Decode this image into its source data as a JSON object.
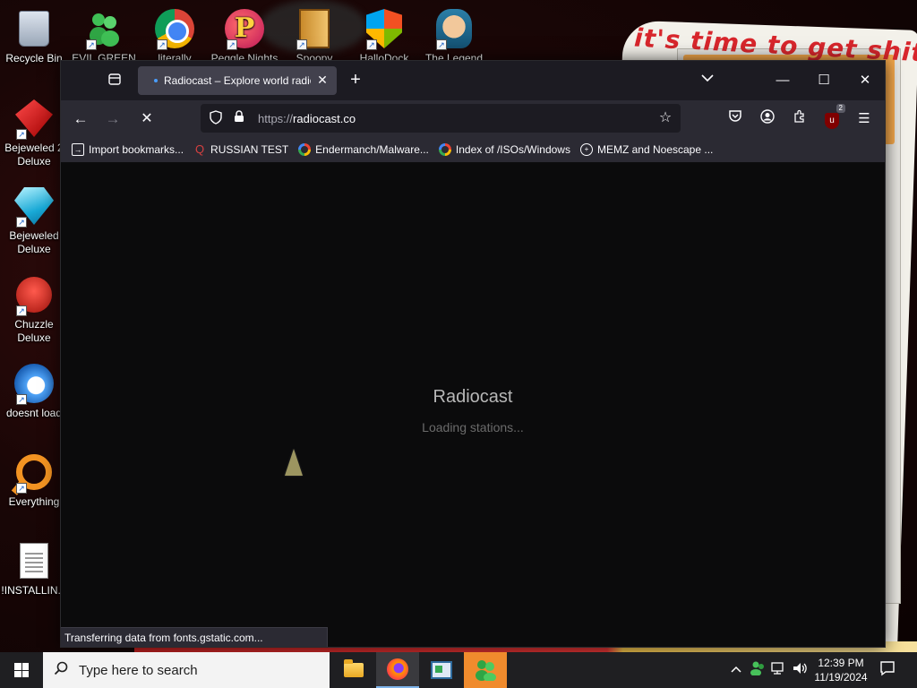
{
  "desktop": {
    "background_headline": "it's time to get shit",
    "icons": [
      {
        "label": "Recycle Bin",
        "icon": "recycle-bin-icon"
      },
      {
        "label": "EVIL GREEN",
        "icon": "people-icon"
      },
      {
        "label": "literally",
        "icon": "chrome-icon"
      },
      {
        "label": "Peggle Nights",
        "icon": "peggle-icon"
      },
      {
        "label": "Spoopy",
        "icon": "door-icon"
      },
      {
        "label": "HalloDock",
        "icon": "windows-shield-icon"
      },
      {
        "label": "The Legend",
        "icon": "pirate-icon"
      },
      {
        "label": "Bejeweled 2 Deluxe",
        "icon": "red-gem-icon"
      },
      {
        "label": "Bejeweled Deluxe",
        "icon": "blue-gem-icon"
      },
      {
        "label": "Chuzzle Deluxe",
        "icon": "chuzzle-icon"
      },
      {
        "label": "doesnt load",
        "icon": "thunderbird-icon"
      },
      {
        "label": "Everything",
        "icon": "everything-search-icon"
      },
      {
        "label": "!INSTALLIN...",
        "icon": "text-file-icon"
      }
    ]
  },
  "browser": {
    "tab": {
      "title": "Radiocast – Explore world radio"
    },
    "url": {
      "protocol": "https://",
      "host": "radiocast.co"
    },
    "bookmarks": [
      {
        "label": "Import bookmarks...",
        "icon": "import-icon"
      },
      {
        "label": "RUSSIAN TEST",
        "icon": "magnifier-icon"
      },
      {
        "label": "Endermanch/Malware...",
        "icon": "google-icon"
      },
      {
        "label": "Index of /ISOs/Windows",
        "icon": "google-icon"
      },
      {
        "label": "MEMZ and Noescape ...",
        "icon": "globe-icon"
      }
    ],
    "extension_badge": "2",
    "page": {
      "title": "Radiocast",
      "loading_text": "Loading stations..."
    },
    "status": "Transferring data from fonts.gstatic.com..."
  },
  "taskbar": {
    "search_placeholder": "Type here to search",
    "time": "12:39 PM",
    "date": "11/19/2024"
  }
}
